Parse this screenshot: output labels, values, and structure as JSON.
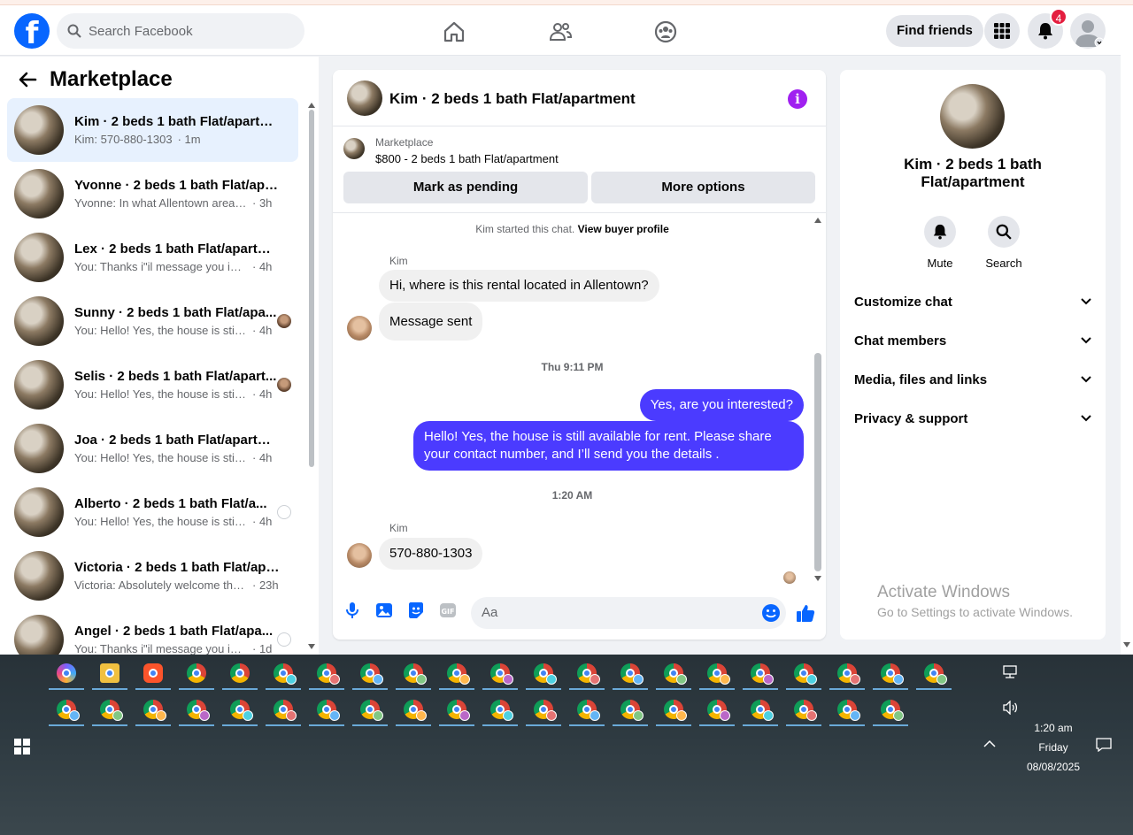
{
  "topbar": {
    "search_placeholder": "Search Facebook",
    "find_friends": "Find friends",
    "notification_count": "4"
  },
  "sidebar": {
    "title": "Marketplace",
    "conversations": [
      {
        "title": "Kim · 2 beds 1 bath Flat/apartme...",
        "snippet": "Kim: 570-880-1303",
        "time": "· 1m",
        "active": true
      },
      {
        "title": "Yvonne · 2 beds 1 bath Flat/apar...",
        "snippet": "Yvonne: In what Allentown area is l...",
        "time": "· 3h"
      },
      {
        "title": "Lex · 2 beds 1 bath Flat/apartment",
        "snippet": "You: Thanks i\"il message you in a ...",
        "time": "· 4h"
      },
      {
        "title": "Sunny · 2 beds 1 bath Flat/apa...",
        "snippet": "You: Hello! Yes, the house is still ...",
        "time": "· 4h"
      },
      {
        "title": "Selis · 2 beds 1 bath Flat/apart...",
        "snippet": "You: Hello! Yes, the house is still ...",
        "time": "· 4h"
      },
      {
        "title": "Joa · 2 beds 1 bath Flat/apartment",
        "snippet": "You: Hello! Yes, the house is still av...",
        "time": "· 4h"
      },
      {
        "title": "Alberto · 2 beds 1 bath Flat/a...",
        "snippet": "You: Hello! Yes, the house is still ...",
        "time": "· 4h"
      },
      {
        "title": "Victoria · 2 beds 1 bath Flat/apar...",
        "snippet": "Victoria: Absolutely welcome than...",
        "time": "· 23h"
      },
      {
        "title": "Angel · 2 beds 1 bath Flat/apa...",
        "snippet": "You: Thanks i\"il message you in ...",
        "time": "· 1d"
      }
    ]
  },
  "chat": {
    "title": "Kim · 2 beds 1 bath Flat/apartment",
    "marketplace_label": "Marketplace",
    "listing": "$800 - 2 beds 1 bath Flat/apartment",
    "mark_pending": "Mark as pending",
    "more_options": "More options",
    "started_text": "Kim started this chat.",
    "view_profile": "View buyer profile",
    "sender_name": "Kim",
    "msg1": "Hi, where is this rental located in Allentown?",
    "msg2": "Message sent",
    "time1": "Thu 9:11 PM",
    "reply1": "Yes, are you interested?",
    "reply2": "Hello! Yes, the house is still available for rent. Please share your contact number, and I’ll send you the details .",
    "time2": "1:20 AM",
    "msg3": "570-880-1303",
    "composer_placeholder": "Aa"
  },
  "details": {
    "title": "Kim · 2 beds 1 bath Flat/apartment",
    "mute": "Mute",
    "search": "Search",
    "rows": [
      "Customize chat",
      "Chat members",
      "Media, files and links",
      "Privacy & support"
    ]
  },
  "watermark": {
    "line1": "Activate Windows",
    "line2": "Go to Settings to activate Windows."
  },
  "taskbar": {
    "time": "1:20 am",
    "day": "Friday",
    "date": "08/08/2025"
  },
  "colors": {
    "brand": "#0866ff",
    "outgoing_bubble": "#4b3bff",
    "active_conversation": "#e7f1fe",
    "info_icon": "#a020f0"
  }
}
